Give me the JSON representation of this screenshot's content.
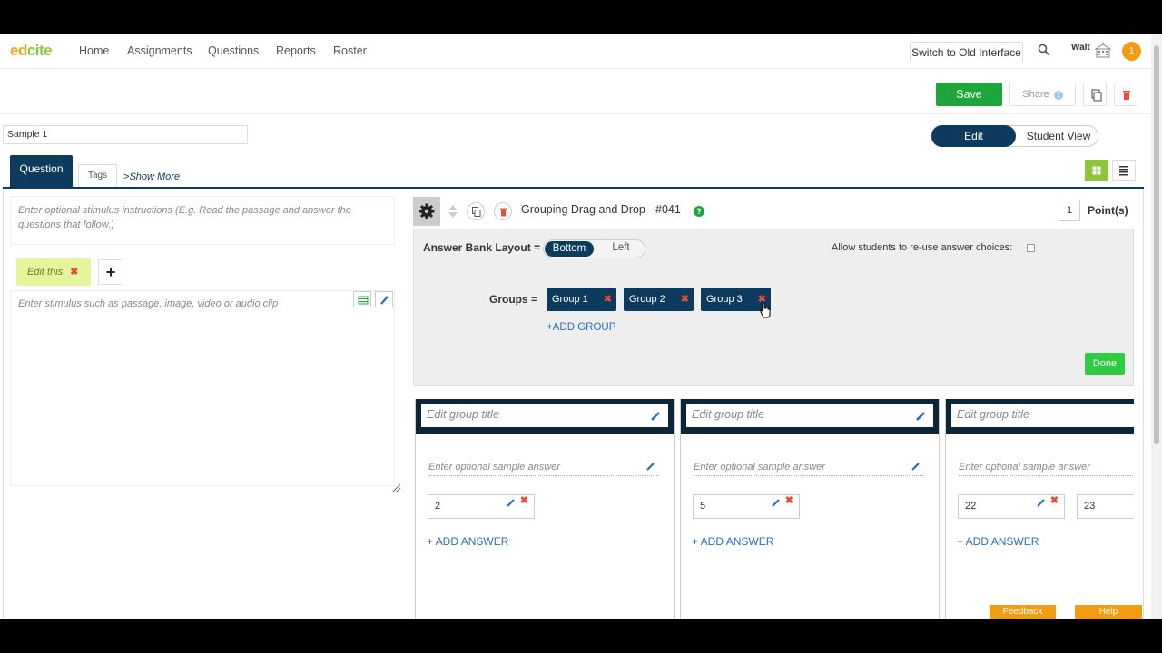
{
  "nav": {
    "logo_a": "ed",
    "logo_b": "cite",
    "links": [
      "Home",
      "Assignments",
      "Questions",
      "Reports",
      "Roster"
    ],
    "old_interface": "Switch to Old Interface",
    "user": "Walt",
    "notifications": "1"
  },
  "actions": {
    "save": "Save",
    "share": "Share",
    "share_help": "?"
  },
  "title_value": "Sample 1",
  "view_toggle": {
    "active": "Edit",
    "inactive": "Student View"
  },
  "tabs": {
    "question": "Question",
    "tags": "Tags",
    "show_more": "Show More"
  },
  "left": {
    "stimulus_instructions": "Enter optional stimulus instructions (E.g. Read the passage and answer the questions that follow.)",
    "edit_this": "Edit this",
    "edit_this_remove": "✖",
    "add": "+",
    "stimulus_placeholder": "Enter stimulus such as passage, image, video or audio clip"
  },
  "question": {
    "title": "Grouping Drag and Drop - #041",
    "help": "?",
    "points_value": "1",
    "points_label": "Point(s)"
  },
  "settings": {
    "answer_bank_label": "Answer Bank Layout =",
    "layout_active": "Bottom",
    "layout_inactive": "Left",
    "reuse_label": "Allow students to re-use answer choices:",
    "groups_label": "Groups =",
    "groups": [
      "Group 1",
      "Group 2",
      "Group 3"
    ],
    "remove": "✖",
    "add_group": "+ADD GROUP",
    "done": "Done"
  },
  "columns": [
    {
      "title": "Edit group title",
      "sample": "Enter optional sample answer",
      "answers": [
        "2"
      ],
      "add": "+ ADD ANSWER"
    },
    {
      "title": "Edit group title",
      "sample": "Enter optional sample answer",
      "answers": [
        "5"
      ],
      "add": "+ ADD ANSWER"
    },
    {
      "title": "Edit group title",
      "sample": "Enter optional sample answer",
      "answers": [
        "22",
        "23"
      ],
      "add": "+ ADD ANSWER"
    }
  ],
  "footer": {
    "feedback": "Feedback",
    "help": "Help"
  },
  "colors": {
    "primary": "#0c3b5e",
    "green": "#1ea63a",
    "accent": "#f39c12",
    "remove": "#e74c3c",
    "link": "#2a6ebb"
  }
}
